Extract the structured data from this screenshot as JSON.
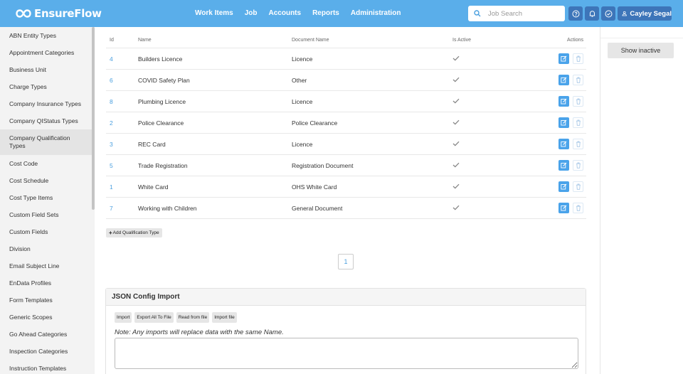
{
  "app": {
    "name": "EnsureFlow"
  },
  "nav": {
    "items": [
      "Work Items",
      "Job",
      "Accounts",
      "Reports",
      "Administration"
    ]
  },
  "search": {
    "placeholder": "Job Search",
    "value": ""
  },
  "user": {
    "name": "Cayley Segal"
  },
  "sidebar": {
    "items": [
      "ABN Entity Types",
      "Appointment Categories",
      "Business Unit",
      "Charge Types",
      "Company Insurance Types",
      "Company QIStatus Types",
      "Company Qualification Types",
      "Cost Code",
      "Cost Schedule",
      "Cost Type Items",
      "Custom Field Sets",
      "Custom Fields",
      "Division",
      "Email Subject Line",
      "EnData Profiles",
      "Form Templates",
      "Generic Scopes",
      "Go Ahead Categories",
      "Inspection Categories",
      "Instruction Templates"
    ],
    "active_index": 6
  },
  "table": {
    "headers": {
      "id": "Id",
      "name": "Name",
      "document": "Document Name",
      "active": "Is Active",
      "actions": "Actions"
    },
    "rows": [
      {
        "id": "4",
        "name": "Builders Licence",
        "document": "Licence"
      },
      {
        "id": "6",
        "name": "COVID Safety Plan",
        "document": "Other"
      },
      {
        "id": "8",
        "name": "Plumbing Licence",
        "document": "Licence"
      },
      {
        "id": "2",
        "name": "Police Clearance",
        "document": "Police Clearance"
      },
      {
        "id": "3",
        "name": "REC Card",
        "document": "Licence"
      },
      {
        "id": "5",
        "name": "Trade Registration",
        "document": "Registration Document"
      },
      {
        "id": "1",
        "name": "White Card",
        "document": "OHS White Card"
      },
      {
        "id": "7",
        "name": "Working with Children",
        "document": "General Document"
      }
    ]
  },
  "add_button": {
    "label": "Add Qualification Type"
  },
  "pagination": {
    "current": "1"
  },
  "json_panel": {
    "title": "JSON Config Import",
    "buttons": [
      "Import",
      "Export All To File",
      "Read from file",
      "Import file"
    ],
    "note": "Note: Any imports will replace data with the same Name.",
    "textarea_value": ""
  },
  "right": {
    "show_inactive": "Show inactive"
  },
  "colors": {
    "topbar": "#5aaeea",
    "button_dark": "#3d75b9",
    "link": "#4a9fdf",
    "edit": "#4aa3ea"
  }
}
